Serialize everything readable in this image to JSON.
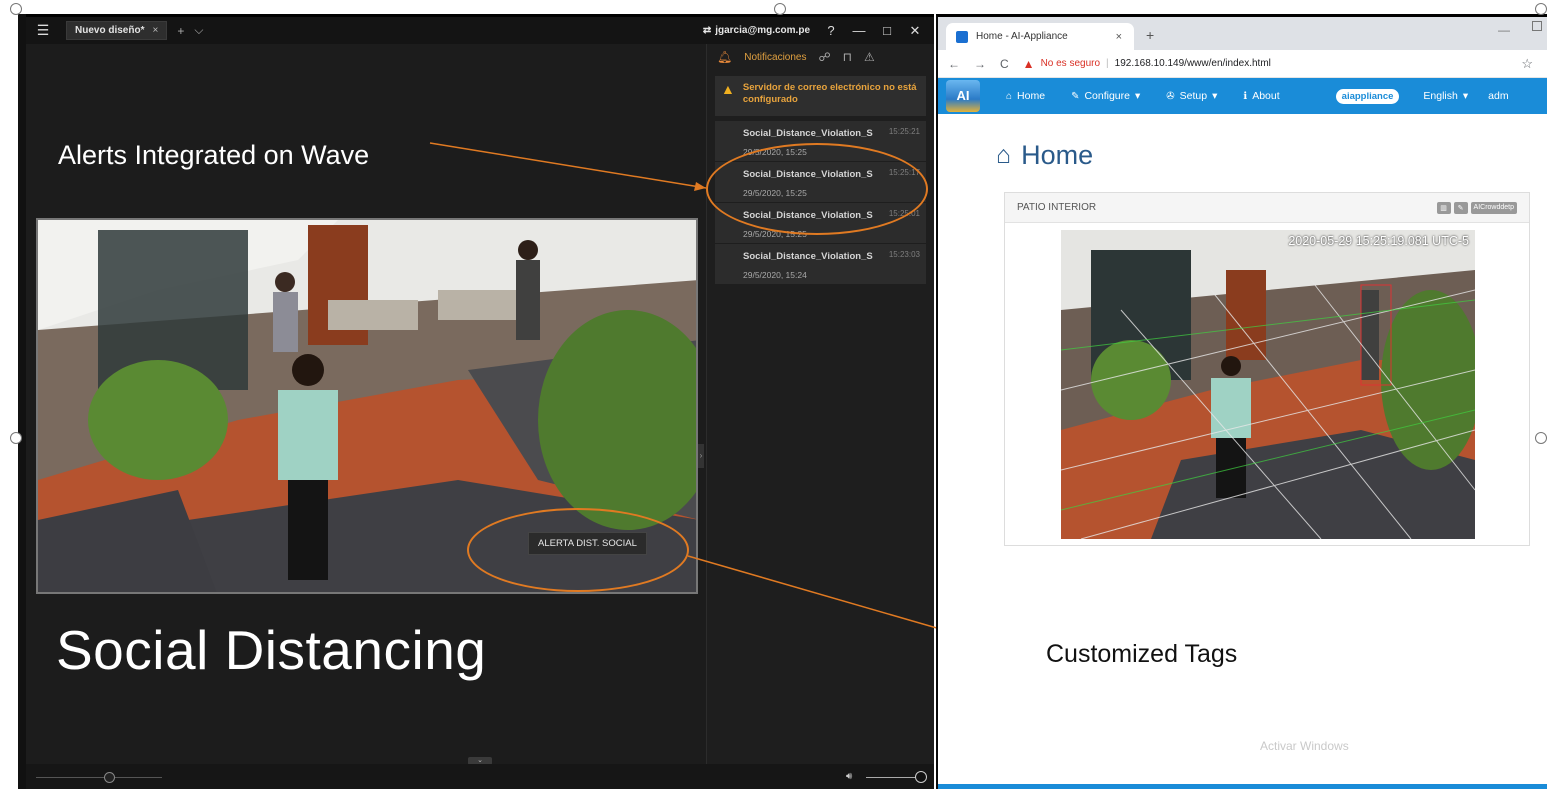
{
  "wave": {
    "tab_label": "Nuevo diseño*",
    "tab_close": "×",
    "plus": "+",
    "chevron": "⌵",
    "user": "jgarcia@mg.com.pe",
    "help": "?",
    "minimize": "—",
    "maximize": "□",
    "close": "✕",
    "notifications": {
      "header": "Notificaciones",
      "warning": "Servidor de correo electrónico no está configurado",
      "items": [
        {
          "name": "Social_Distance_Violation_S",
          "time": "15:25:21",
          "date": "29/5/2020, 15:25"
        },
        {
          "name": "Social_Distance_Violation_S",
          "time": "15:25:17",
          "date": "29/5/2020, 15:25"
        },
        {
          "name": "Social_Distance_Violation_S",
          "time": "15:25:01",
          "date": "29/5/2020, 15:25"
        },
        {
          "name": "Social_Distance_Violation_S",
          "time": "15:23:03",
          "date": "29/5/2020, 15:24"
        }
      ]
    },
    "video_tag": "ALERTA DIST. SOCIAL"
  },
  "captions": {
    "alerts": "Alerts Integrated on Wave",
    "main": "Social Distancing",
    "tags": "Customized Tags"
  },
  "browser": {
    "tab_title": "Home - AI-Appliance",
    "tab_close": "×",
    "new_tab": "+",
    "insecure_label": "No es seguro",
    "url": "192.168.10.149/www/en/index.html",
    "logo_text": "AI",
    "nav": {
      "home": "Home",
      "configure": "Configure",
      "setup": "Setup",
      "about": "About",
      "badge": "aiappliance",
      "language": "English",
      "admin": "adm"
    },
    "page_title": "Home",
    "panel_title": "PATIO INTERIOR",
    "panel_button": "AICrowddetp",
    "timestamp": "2020-05-29 15:25:19.081 UTC-5",
    "watermark": "Activar Windows"
  },
  "colors": {
    "accent_orange": "#e07a22",
    "browser_nav_blue": "#1a8cd8",
    "wave_bg": "#1c1c1c"
  }
}
